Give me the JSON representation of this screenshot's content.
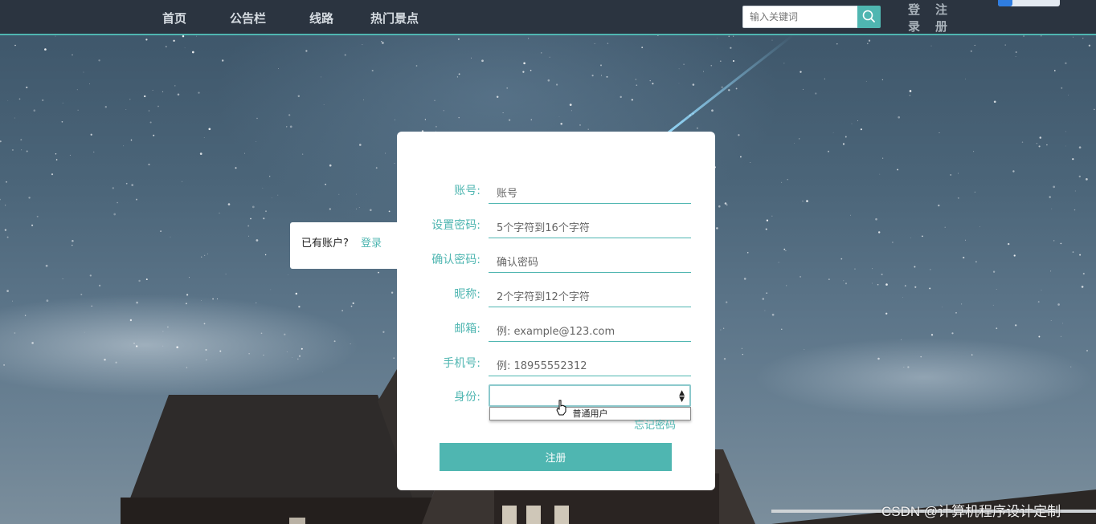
{
  "nav": {
    "items": [
      {
        "label": "首页"
      },
      {
        "label": "公告栏"
      },
      {
        "label": "线路"
      },
      {
        "label": "热门景点"
      }
    ],
    "search_placeholder": "输入关键词",
    "login": "登录",
    "register": "注册"
  },
  "side": {
    "question": "已有账户?",
    "login_link": "登录"
  },
  "form": {
    "fields": [
      {
        "label": "账号:",
        "placeholder": "账号"
      },
      {
        "label": "设置密码:",
        "placeholder": "5个字符到16个字符"
      },
      {
        "label": "确认密码:",
        "placeholder": "确认密码"
      },
      {
        "label": "昵称:",
        "placeholder": "2个字符到12个字符"
      },
      {
        "label": "邮箱:",
        "placeholder": "例: example@123.com"
      },
      {
        "label": "手机号:",
        "placeholder": "例: 18955552312"
      }
    ],
    "role_label": "身份:",
    "role_value": "",
    "role_options": [
      "普通用户"
    ],
    "forgot": "忘记密码",
    "submit": "注册"
  },
  "watermark": "CSDN @计算机程序设计定制",
  "colors": {
    "accent": "#4fb6b1",
    "navbar": "#2b3440"
  }
}
